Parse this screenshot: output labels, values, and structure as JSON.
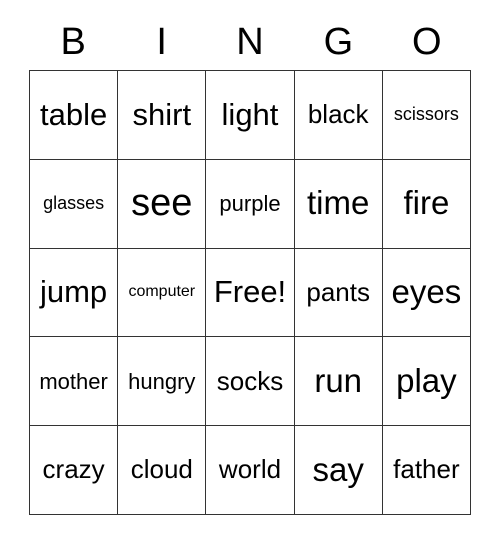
{
  "card": {
    "header": {
      "letters": [
        "B",
        "I",
        "N",
        "G",
        "O"
      ]
    },
    "rows": [
      [
        {
          "label": "table",
          "size": "fs-xl"
        },
        {
          "label": "shirt",
          "size": "fs-xl"
        },
        {
          "label": "light",
          "size": "fs-xl"
        },
        {
          "label": "black",
          "size": "fs-lg"
        },
        {
          "label": "scissors",
          "size": "fs-sm"
        }
      ],
      [
        {
          "label": "glasses",
          "size": "fs-sm"
        },
        {
          "label": "see",
          "size": "fs-huge"
        },
        {
          "label": "purple",
          "size": "fs-md"
        },
        {
          "label": "time",
          "size": "fs-xxl"
        },
        {
          "label": "fire",
          "size": "fs-xxl"
        }
      ],
      [
        {
          "label": "jump",
          "size": "fs-xl"
        },
        {
          "label": "computer",
          "size": "fs-xs"
        },
        {
          "label": "Free!",
          "size": "fs-xl"
        },
        {
          "label": "pants",
          "size": "fs-lg"
        },
        {
          "label": "eyes",
          "size": "fs-xxl"
        }
      ],
      [
        {
          "label": "mother",
          "size": "fs-md"
        },
        {
          "label": "hungry",
          "size": "fs-md"
        },
        {
          "label": "socks",
          "size": "fs-lg"
        },
        {
          "label": "run",
          "size": "fs-xxl"
        },
        {
          "label": "play",
          "size": "fs-xxl"
        }
      ],
      [
        {
          "label": "crazy",
          "size": "fs-lg"
        },
        {
          "label": "cloud",
          "size": "fs-lg"
        },
        {
          "label": "world",
          "size": "fs-lg"
        },
        {
          "label": "say",
          "size": "fs-xxl"
        },
        {
          "label": "father",
          "size": "fs-lg"
        }
      ]
    ],
    "free_space": {
      "row": 2,
      "column": 2,
      "label": "Free!"
    },
    "colors": {
      "background": "#ffffff",
      "text": "#000000",
      "grid_line": "#333333"
    }
  }
}
